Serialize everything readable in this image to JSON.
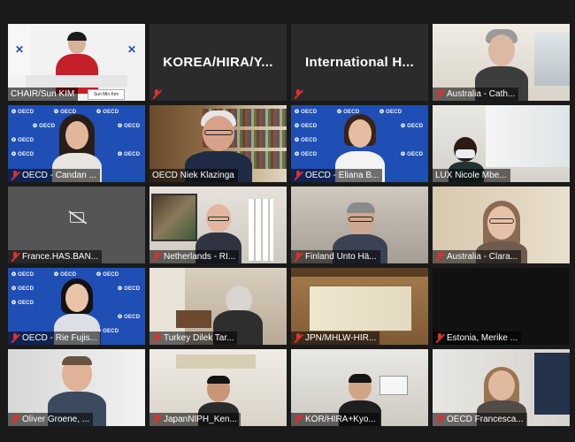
{
  "app": "video-conference-gallery",
  "oecd_logo_text": "OECD",
  "tiles": [
    {
      "label": "CHAIR/Sun KIM",
      "muted": false,
      "type": "chair",
      "stage_text": "Sun Min Kim"
    },
    {
      "label": "",
      "muted": true,
      "type": "name-only",
      "display_name": "KOREA/HIRA/Y..."
    },
    {
      "label": "",
      "muted": true,
      "type": "name-only",
      "display_name": "International  H..."
    },
    {
      "label": "Australia - Cath...",
      "muted": true,
      "type": "video"
    },
    {
      "label": "OECD - Candan ...",
      "muted": true,
      "type": "oecd"
    },
    {
      "label": "OECD Niek Klazinga",
      "muted": false,
      "type": "books",
      "active": true
    },
    {
      "label": "OECD - Eliana B...",
      "muted": true,
      "type": "oecd"
    },
    {
      "label": "LUX Nicole Mbe...",
      "muted": false,
      "type": "video"
    },
    {
      "label": "France.HAS.BAN...",
      "muted": true,
      "type": "cam-off"
    },
    {
      "label": "Netherlands - RI...",
      "muted": true,
      "type": "video"
    },
    {
      "label": "Finland Unto Hä...",
      "muted": true,
      "type": "video"
    },
    {
      "label": "Australia - Clara...",
      "muted": true,
      "type": "video"
    },
    {
      "label": "OECD - Rie Fujis...",
      "muted": true,
      "type": "oecd"
    },
    {
      "label": "Turkey Dilek Tar...",
      "muted": true,
      "type": "video"
    },
    {
      "label": "JPN/MHLW-HIR...",
      "muted": true,
      "type": "japanese-room"
    },
    {
      "label": "Estonia, Merike ...",
      "muted": true,
      "type": "black"
    },
    {
      "label": "Oliver Groene, ...",
      "muted": true,
      "type": "video"
    },
    {
      "label": "JapanNIPH_Ken...",
      "muted": true,
      "type": "video"
    },
    {
      "label": "KOR/HIRA+Kyo...",
      "muted": true,
      "type": "video"
    },
    {
      "label": "OECD Francesca...",
      "muted": true,
      "type": "video"
    }
  ],
  "colors": {
    "background": "#1a1a1a",
    "active_speaker_border": "#c8d400",
    "muted_icon": "#e02f2f",
    "oecd_blue": "#1f4fb4"
  }
}
